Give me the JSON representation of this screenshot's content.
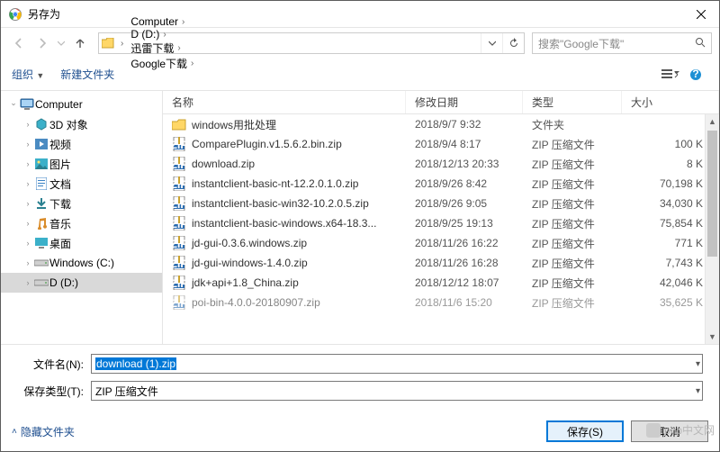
{
  "title": "另存为",
  "breadcrumb": [
    "Computer",
    "D (D:)",
    "迅雷下载",
    "Google下载"
  ],
  "search_placeholder": "搜索\"Google下载\"",
  "toolbar": {
    "organize": "组织",
    "new_folder": "新建文件夹"
  },
  "columns": {
    "name": "名称",
    "date": "修改日期",
    "type": "类型",
    "size": "大小"
  },
  "tree": [
    {
      "label": "Computer",
      "icon": "computer",
      "exp": "expanded",
      "sub": false
    },
    {
      "label": "3D 对象",
      "icon": "3d",
      "sub": true
    },
    {
      "label": "视频",
      "icon": "video",
      "sub": true
    },
    {
      "label": "图片",
      "icon": "pictures",
      "sub": true
    },
    {
      "label": "文档",
      "icon": "docs",
      "sub": true
    },
    {
      "label": "下载",
      "icon": "downloads",
      "sub": true
    },
    {
      "label": "音乐",
      "icon": "music",
      "sub": true
    },
    {
      "label": "桌面",
      "icon": "desktop",
      "sub": true
    },
    {
      "label": "Windows (C:)",
      "icon": "drive",
      "sub": true
    },
    {
      "label": "D (D:)",
      "icon": "drive",
      "sub": true,
      "selected": true
    }
  ],
  "files": [
    {
      "icon": "folder",
      "name": "windows用批处理",
      "date": "2018/9/7 9:32",
      "type": "文件夹",
      "size": ""
    },
    {
      "icon": "zip",
      "name": "ComparePlugin.v1.5.6.2.bin.zip",
      "date": "2018/9/4 8:17",
      "type": "ZIP 压缩文件",
      "size": "100 K"
    },
    {
      "icon": "zip",
      "name": "download.zip",
      "date": "2018/12/13 20:33",
      "type": "ZIP 压缩文件",
      "size": "8 K"
    },
    {
      "icon": "zip",
      "name": "instantclient-basic-nt-12.2.0.1.0.zip",
      "date": "2018/9/26 8:42",
      "type": "ZIP 压缩文件",
      "size": "70,198 K"
    },
    {
      "icon": "zip",
      "name": "instantclient-basic-win32-10.2.0.5.zip",
      "date": "2018/9/26 9:05",
      "type": "ZIP 压缩文件",
      "size": "34,030 K"
    },
    {
      "icon": "zip",
      "name": "instantclient-basic-windows.x64-18.3...",
      "date": "2018/9/25 19:13",
      "type": "ZIP 压缩文件",
      "size": "75,854 K"
    },
    {
      "icon": "zip",
      "name": "jd-gui-0.3.6.windows.zip",
      "date": "2018/11/26 16:22",
      "type": "ZIP 压缩文件",
      "size": "771 K"
    },
    {
      "icon": "zip",
      "name": "jd-gui-windows-1.4.0.zip",
      "date": "2018/11/26 16:28",
      "type": "ZIP 压缩文件",
      "size": "7,743 K"
    },
    {
      "icon": "zip",
      "name": "jdk+api+1.8_China.zip",
      "date": "2018/12/12 18:07",
      "type": "ZIP 压缩文件",
      "size": "42,046 K"
    },
    {
      "icon": "zip",
      "name": "poi-bin-4.0.0-20180907.zip",
      "date": "2018/11/6 15:20",
      "type": "ZIP 压缩文件",
      "size": "35,625 K",
      "cut": true
    }
  ],
  "filename_label": "文件名(N):",
  "filename_value": "download (1).zip",
  "filetype_label": "保存类型(T):",
  "filetype_value": "ZIP 压缩文件",
  "hide_folders": "隐藏文件夹",
  "save_btn": "保存(S)",
  "cancel_btn": "取消",
  "watermark": "php中文网"
}
